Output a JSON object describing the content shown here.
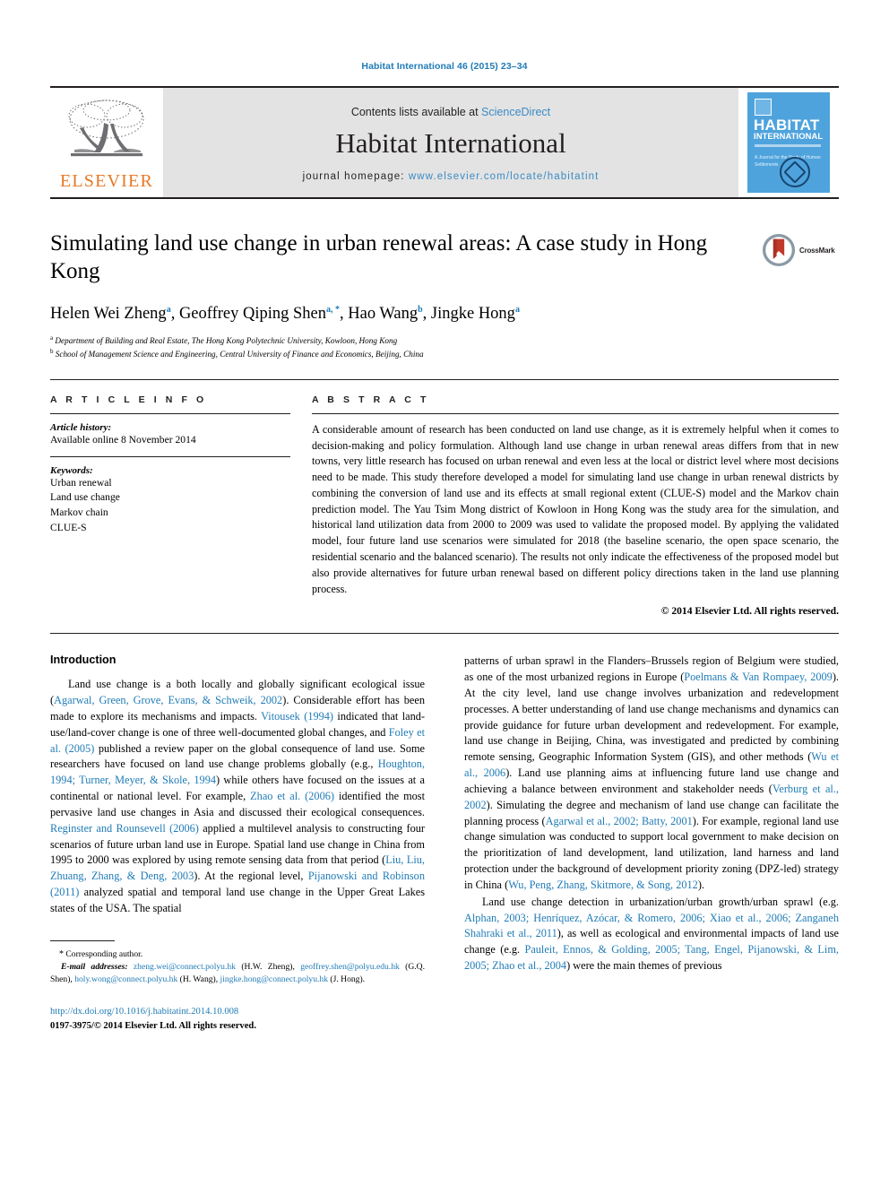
{
  "running_head": "Habitat International 46 (2015) 23–34",
  "masthead": {
    "publisher_name": "ELSEVIER",
    "publisher_logo_icon": "elsevier-tree-logo",
    "contents_prefix": "Contents lists available at ",
    "contents_link": "ScienceDirect",
    "journal_name": "Habitat International",
    "homepage_prefix": "journal homepage: ",
    "homepage_url": "www.elsevier.com/locate/habitatint",
    "cover": {
      "title_line1": "HABITAT",
      "title_line2": "INTERNATIONAL",
      "subtitle": "A Journal for the Study of Human Settlements",
      "emblem_icon": "habitat-circular-emblem"
    }
  },
  "article": {
    "title": "Simulating land use change in urban renewal areas: A case study in Hong Kong",
    "crossmark": {
      "label": "CrossMark",
      "icon": "crossmark-badge-icon"
    },
    "authors": [
      {
        "name": "Helen Wei Zheng",
        "marks": "a"
      },
      {
        "name": "Geoffrey Qiping Shen",
        "marks": "a, *"
      },
      {
        "name": "Hao Wang",
        "marks": "b"
      },
      {
        "name": "Jingke Hong",
        "marks": "a"
      }
    ],
    "affiliations": [
      {
        "mark": "a",
        "text": "Department of Building and Real Estate, The Hong Kong Polytechnic University, Kowloon, Hong Kong"
      },
      {
        "mark": "b",
        "text": "School of Management Science and Engineering, Central University of Finance and Economics, Beijing, China"
      }
    ]
  },
  "article_info": {
    "heading": "A R T I C L E   I N F O",
    "history_label": "Article history:",
    "history_value": "Available online 8 November 2014",
    "keywords_label": "Keywords:",
    "keywords": [
      "Urban renewal",
      "Land use change",
      "Markov chain",
      "CLUE-S"
    ]
  },
  "abstract": {
    "heading": "A B S T R A C T",
    "text": "A considerable amount of research has been conducted on land use change, as it is extremely helpful when it comes to decision-making and policy formulation. Although land use change in urban renewal areas differs from that in new towns, very little research has focused on urban renewal and even less at the local or district level where most decisions need to be made. This study therefore developed a model for simulating land use change in urban renewal districts by combining the conversion of land use and its effects at small regional extent (CLUE-S) model and the Markov chain prediction model. The Yau Tsim Mong district of Kowloon in Hong Kong was the study area for the simulation, and historical land utilization data from 2000 to 2009 was used to validate the proposed model. By applying the validated model, four future land use scenarios were simulated for 2018 (the baseline scenario, the open space scenario, the residential scenario and the balanced scenario). The results not only indicate the effectiveness of the proposed model but also provide alternatives for future urban renewal based on different policy directions taken in the land use planning process.",
    "copyright": "© 2014 Elsevier Ltd. All rights reserved."
  },
  "introduction": {
    "heading": "Introduction",
    "left_paragraph_1_html": "Land use change is a both locally and globally significant ecological issue (<span class=\"cite\">Agarwal, Green, Grove, Evans, &amp; Schweik, 2002</span>). Considerable effort has been made to explore its mechanisms and impacts. <span class=\"cite\">Vitousek (1994)</span> indicated that land-use/land-cover change is one of three well-documented global changes, and <span class=\"cite\">Foley et al. (2005)</span> published a review paper on the global consequence of land use. Some researchers have focused on land use change problems globally (e.g., <span class=\"cite\">Houghton, 1994; Turner, Meyer, &amp; Skole, 1994</span>) while others have focused on the issues at a continental or national level. For example, <span class=\"cite\">Zhao et al. (2006)</span> identified the most pervasive land use changes in Asia and discussed their ecological consequences. <span class=\"cite\">Reginster and Rounsevell (2006)</span> applied a multilevel analysis to constructing four scenarios of future urban land use in Europe. Spatial land use change in China from 1995 to 2000 was explored by using remote sensing data from that period (<span class=\"cite\">Liu, Liu, Zhuang, Zhang, &amp; Deng, 2003</span>). At the regional level, <span class=\"cite\">Pijanowski and Robinson (2011)</span> analyzed spatial and temporal land use change in the Upper Great Lakes states of the USA. The spatial",
    "right_paragraph_1_html": "patterns of urban sprawl in the Flanders–Brussels region of Belgium were studied, as one of the most urbanized regions in Europe (<span class=\"cite\">Poelmans &amp; Van Rompaey, 2009</span>). At the city level, land use change involves urbanization and redevelopment processes. A better understanding of land use change mechanisms and dynamics can provide guidance for future urban development and redevelopment. For example, land use change in Beijing, China, was investigated and predicted by combining remote sensing, Geographic Information System (GIS), and other methods (<span class=\"cite\">Wu et al., 2006</span>). Land use planning aims at influencing future land use change and achieving a balance between environment and stakeholder needs (<span class=\"cite\">Verburg et al., 2002</span>). Simulating the degree and mechanism of land use change can facilitate the planning process (<span class=\"cite\">Agarwal et al., 2002; Batty, 2001</span>). For example, regional land use change simulation was conducted to support local government to make decision on the prioritization of land development, land utilization, land harness and land protection under the background of development priority zoning (DPZ-led) strategy in China (<span class=\"cite\">Wu, Peng, Zhang, Skitmore, &amp; Song, 2012</span>).",
    "right_paragraph_2_html": "Land use change detection in urbanization/urban growth/urban sprawl (e.g. <span class=\"cite\">Alphan, 2003; Henríquez, Azócar, &amp; Romero, 2006; Xiao et al., 2006; Zanganeh Shahraki et al., 2011</span>), as well as ecological and environmental impacts of land use change (e.g. <span class=\"cite\">Pauleit, Ennos, &amp; Golding, 2005; Tang, Engel, Pijanowski, &amp; Lim, 2005; Zhao et al., 2004</span>) were the main themes of previous"
  },
  "footnotes": {
    "corresponding_marker": "*",
    "corresponding_text": "Corresponding author.",
    "email_label": "E-mail addresses:",
    "emails_html": "<span class=\"cite\">zheng.wei@connect.polyu.hk</span> (H.W. Zheng), <span class=\"cite\">geoffrey.shen@polyu.edu.hk</span> (G.Q. Shen), <span class=\"cite\">holy.wong@connect.polyu.hk</span> (H. Wang), <span class=\"cite\">jingke.hong@connect.polyu.hk</span> (J. Hong).",
    "doi_url": "http://dx.doi.org/10.1016/j.habitatint.2014.10.008",
    "issn_line": "0197-3975/© 2014 Elsevier Ltd. All rights reserved."
  },
  "colors": {
    "link_blue": "#1f7bb6",
    "elsevier_orange": "#e87722",
    "masthead_gray": "#e3e3e3",
    "cover_blue": "#4fa3dd"
  }
}
